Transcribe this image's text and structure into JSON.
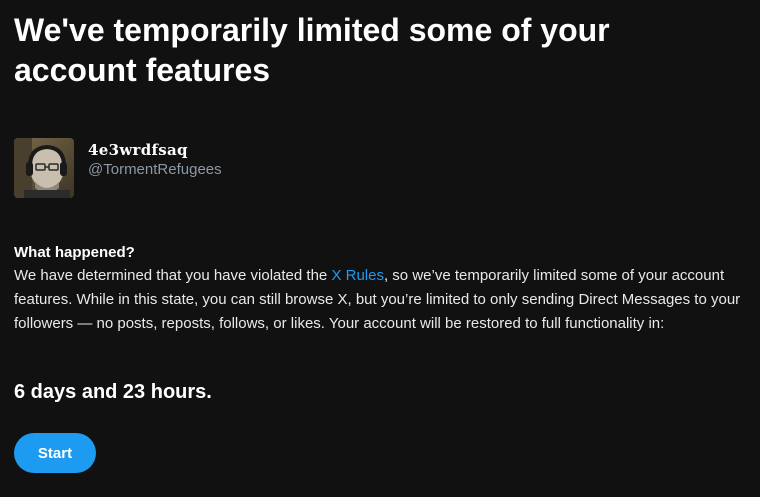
{
  "title": "We've temporarily limited some of your account features",
  "profile": {
    "display_name": "4e3wrdfsaq",
    "handle": "@TormentRefugees"
  },
  "notice": {
    "heading": "What happened?",
    "text_before_link": "We have determined that you have violated the ",
    "link_label": "X Rules",
    "text_after_link": ", so we’ve temporarily limited some of your account features. While in this state, you can still browse X, but you’re limited to only sending Direct Messages to your followers — no posts, reposts, follows, or likes. Your account will be restored to full functionality in:"
  },
  "countdown": "6 days and 23 hours.",
  "start_button_label": "Start",
  "colors": {
    "background": "#111111",
    "accent": "#1d9bf0",
    "secondary_text": "#8b98a5"
  }
}
